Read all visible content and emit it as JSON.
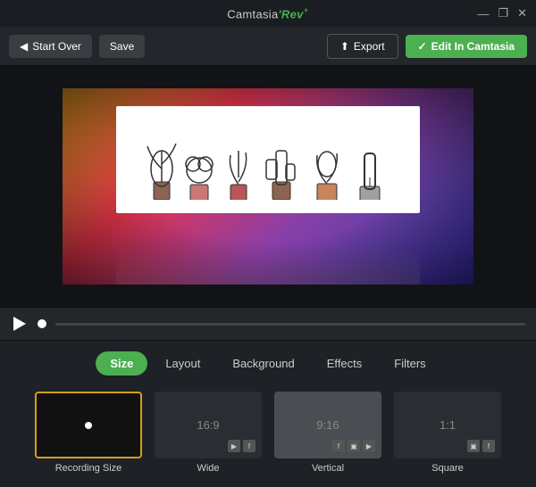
{
  "titleBar": {
    "title": "Camtasia",
    "titleBold": "'Rev",
    "titlePlus": "+",
    "controls": [
      "—",
      "❐",
      "✕"
    ]
  },
  "toolbar": {
    "startOver": "Start Over",
    "save": "Save",
    "export": "Export",
    "editInCamtasia": "Edit In Camtasia"
  },
  "tabs": [
    {
      "id": "size",
      "label": "Size",
      "active": true
    },
    {
      "id": "layout",
      "label": "Layout",
      "active": false
    },
    {
      "id": "background",
      "label": "Background",
      "active": false
    },
    {
      "id": "effects",
      "label": "Effects",
      "active": false
    },
    {
      "id": "filters",
      "label": "Filters",
      "active": false
    }
  ],
  "sizeOptions": [
    {
      "id": "recording",
      "label": "Recording Size",
      "ratio": "",
      "selected": true
    },
    {
      "id": "wide",
      "label": "Wide",
      "ratio": "16:9",
      "selected": false,
      "icons": [
        "yt",
        "fb"
      ]
    },
    {
      "id": "vertical",
      "label": "Vertical",
      "ratio": "9:16",
      "selected": false,
      "icons": [
        "fb",
        "ig",
        "yt"
      ]
    },
    {
      "id": "square",
      "label": "Square",
      "ratio": "1:1",
      "selected": false,
      "icons": [
        "ig",
        "fb"
      ]
    }
  ],
  "plants": [
    "🪴",
    "🌿",
    "🌱",
    "🌵",
    "🪴",
    "🌾"
  ]
}
